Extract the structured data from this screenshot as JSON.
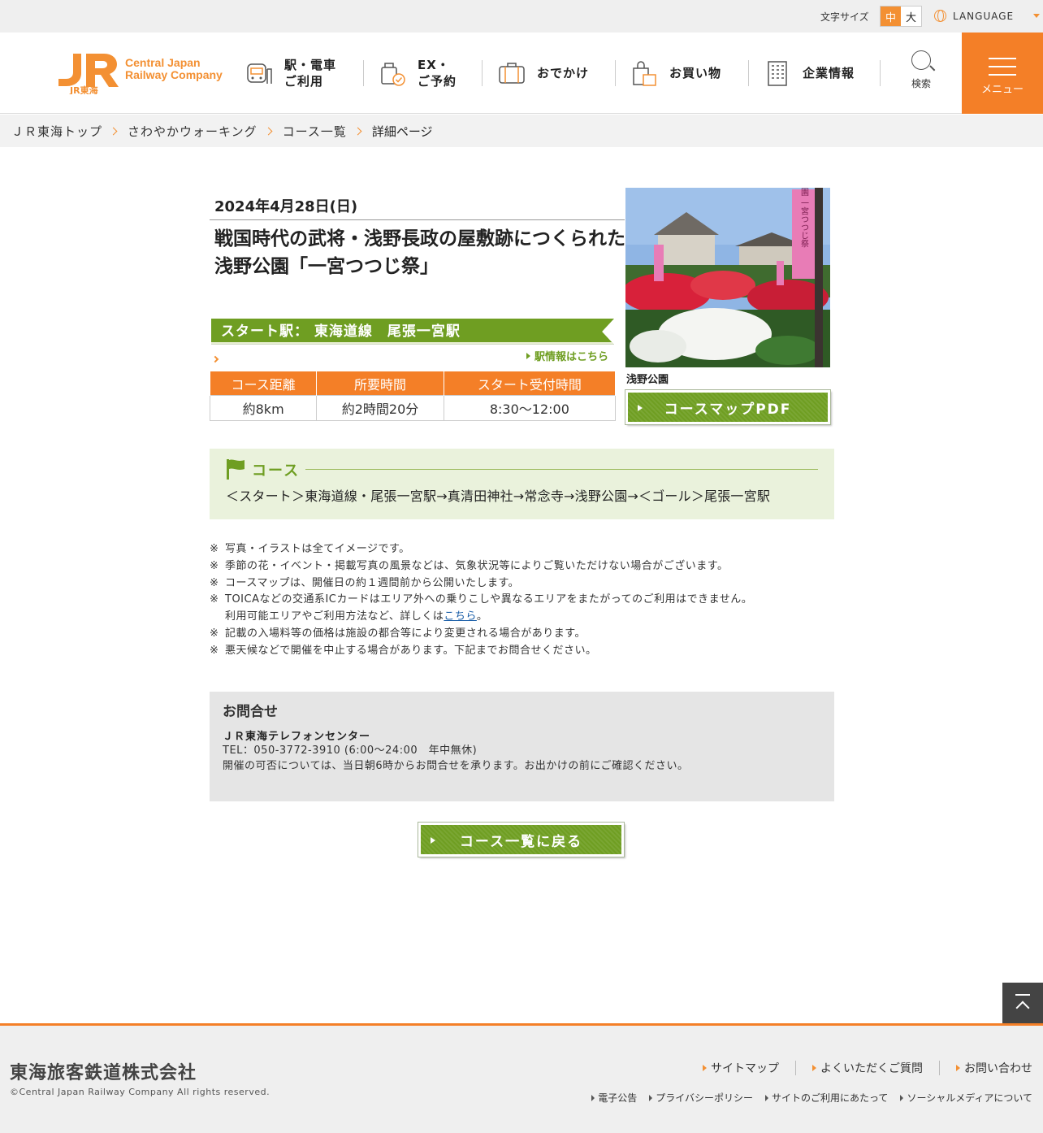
{
  "utility": {
    "font_size_label": "文字サイズ",
    "font_mid": "中",
    "font_large": "大",
    "language": "LANGUAGE"
  },
  "header": {
    "logo_en_line1": "Central Japan",
    "logo_en_line2": "Railway Company",
    "logo_jp": "JR東海",
    "nav": [
      {
        "label": "駅・電車\nご利用",
        "icon": "train-icon"
      },
      {
        "label": "EX・\nご予約",
        "icon": "reservation-icon"
      },
      {
        "label": "おでかけ",
        "icon": "suitcase-icon"
      },
      {
        "label": "お買い物",
        "icon": "shopping-bag-icon"
      },
      {
        "label": "企業情報",
        "icon": "building-icon"
      }
    ],
    "search_label": "検索",
    "menu_label": "メニュー"
  },
  "breadcrumb": [
    "ＪＲ東海トップ",
    "さわやかウォーキング",
    "コース一覧",
    "詳細ページ"
  ],
  "event": {
    "date": "2024年4月28日(日)",
    "title": "戦国時代の武将・浅野長政の屋敷跡につくられた\n浅野公園「一宮つつじ祭」",
    "start_station": "スタート駅：  東海道線　尾張一宮駅",
    "station_link": "駅情報はこちら",
    "table_headers": [
      "コース距離",
      "所要時間",
      "スタート受付時間"
    ],
    "table_values": [
      "約8km",
      "約2時間20分",
      "8:30～12:00"
    ],
    "photo_caption": "浅野公園",
    "photo_banner_text": "浅野公園 一宮つつじ祭",
    "map_button": "コースマップPDF"
  },
  "course": {
    "heading": "コース",
    "route": "＜スタート＞東海道線・尾張一宮駅→真清田神社→常念寺→浅野公園→＜ゴール＞尾張一宮駅"
  },
  "notes": {
    "mark": "※",
    "items": [
      "写真・イラストは全てイメージです。",
      "季節の花・イベント・掲載写真の風景などは、気象状況等によりご覧いただけない場合がございます。",
      "コースマップは、開催日の約１週間前から公開いたします。",
      "TOICAなどの交通系ICカードはエリア外への乗りこしや異なるエリアをまたがってのご利用はできません。"
    ],
    "ic_sub_before": "利用可能エリアやご利用方法など、詳しくは",
    "ic_sub_link": "こちら",
    "ic_sub_after": "。",
    "items2": [
      "記載の入場料等の価格は施設の都合等により変更される場合があります。",
      "悪天候などで開催を中止する場合があります。下記までお問合せください。"
    ]
  },
  "contact": {
    "heading": "お問合せ",
    "org": "ＪＲ東海テレフォンセンター",
    "tel": "TEL：050-3772-3910 (6:00～24:00　年中無休)",
    "desc": "開催の可否については、当日朝6時からお問合せを承ります。お出かけの前にご確認ください。"
  },
  "back_button": "コース一覧に戻る",
  "footer": {
    "company": "東海旅客鉄道株式会社",
    "copyright": "©Central Japan Railway Company All rights reserved.",
    "links_main": [
      "サイトマップ",
      "よくいただくご質問",
      "お問い合わせ"
    ],
    "links_sub": [
      "電子公告",
      "プライバシーポリシー",
      "サイトのご利用にあたって",
      "ソーシャルメディアについて"
    ]
  },
  "colors": {
    "brand_orange": "#f47f27",
    "walking_green": "#6f9e22",
    "course_bg": "#eaf2dc"
  }
}
